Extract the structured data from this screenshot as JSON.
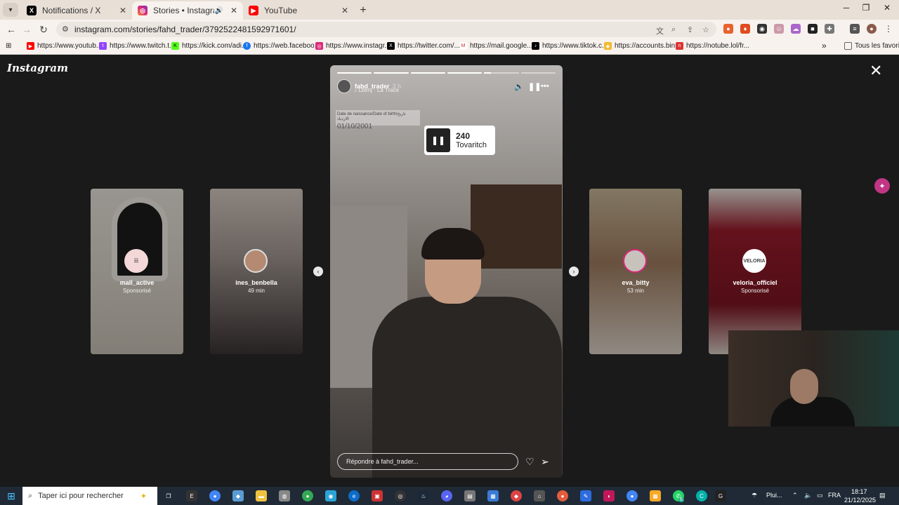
{
  "browser": {
    "tabs": [
      {
        "title": "Notifications / X"
      },
      {
        "title": "Stories • Instagram"
      },
      {
        "title": "YouTube"
      }
    ],
    "url": "instagram.com/stories/fahd_trader/3792522481592971601/",
    "bookmarks": [
      "https://www.youtub...",
      "https://www.twitch.t...",
      "https://kick.com/adi...",
      "https://web.faceboo...",
      "https://www.instagr...",
      "https://twitter.com/...",
      "https://mail.google....",
      "https://www.tiktok.c...",
      "https://accounts.bin...",
      "https://notube.lol/fr..."
    ],
    "all_bookmarks": "Tous les favoris",
    "more_bookmarks": "»"
  },
  "instagram": {
    "logo": "Instagram",
    "close": "✕",
    "side_stories": [
      {
        "name": "mall_active",
        "sub": "Sponsorisé"
      },
      {
        "name": "ines_benbella",
        "sub": "49 min"
      },
      {
        "name": "eva_bitty",
        "sub": "53 min"
      },
      {
        "name": "veloria_officiel",
        "sub": "Sponsorisé",
        "avatar_text": "VELORIA"
      }
    ],
    "story": {
      "username": "fahd_trader",
      "time": "3 h",
      "music": "Lbenj · La Trace",
      "dob_label": "Date de naissance/Date of birth/تاريخ الازدياد",
      "dob_date": "01/10/2001",
      "sticker_line1": "240",
      "sticker_line2": "Tovaritch",
      "reply_placeholder": "Répondre à fahd_trader...",
      "progress_segments": 6,
      "progress_done": 4.2
    }
  },
  "taskbar": {
    "search": "Taper ici pour rechercher",
    "weather": "Plui...",
    "lang": "FRA",
    "time": "18:17",
    "date": "21/12/2025",
    "whatsapp_badge": "6"
  }
}
